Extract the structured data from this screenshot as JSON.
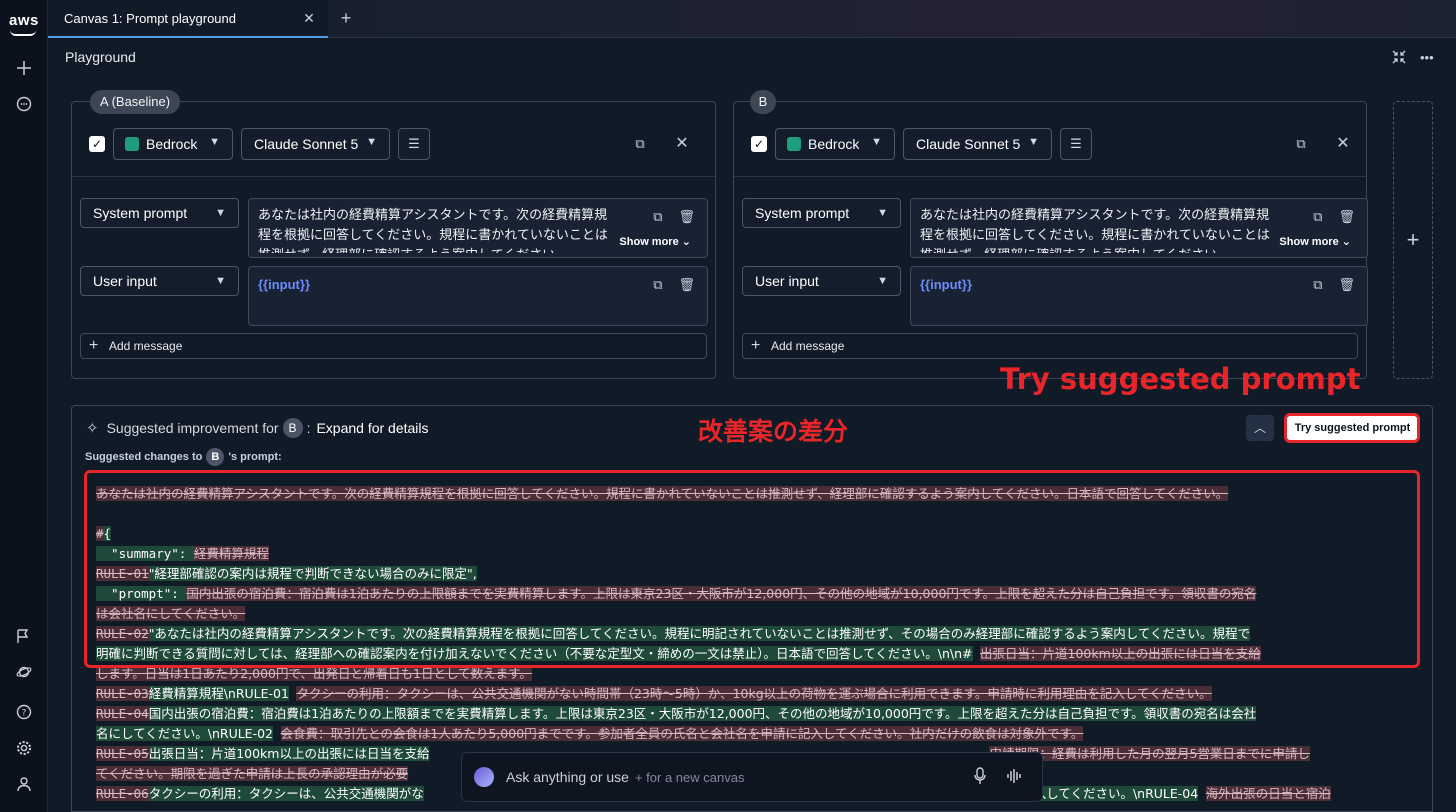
{
  "tab": {
    "title": "Canvas 1: Prompt playground"
  },
  "page": {
    "title": "Playground"
  },
  "panel_a": {
    "tag": "A (Baseline)",
    "provider": "Bedrock",
    "model": "Claude Sonnet 5",
    "system_role": "System prompt",
    "system_text": "あなたは社内の経費精算アシスタントです。次の経費精算規程を根拠に回答してください。規程に書かれていないことは推測せず、経理部に確認するよう案内してください。",
    "show_more": "Show more",
    "user_role": "User input",
    "user_text": "{{input}}",
    "add_message": "Add message"
  },
  "panel_b": {
    "tag": "B",
    "provider": "Bedrock",
    "model": "Claude Sonnet 5",
    "system_role": "System prompt",
    "system_text": "あなたは社内の経費精算アシスタントです。次の経費精算規程を根拠に回答してください。規程に書かれていないことは推測せず、経理部に確認するよう案内してください。",
    "show_more": "Show more",
    "user_role": "User input",
    "user_text": "{{input}}",
    "add_message": "Add message"
  },
  "suggestion": {
    "prefix": "Suggested improvement for",
    "badge": "B",
    "expand": "Expand for details",
    "try_button": "Try suggested prompt",
    "sub_prefix": "Suggested changes to",
    "sub_badge": "B",
    "sub_suffix": "'s prompt:"
  },
  "diff": {
    "l1_del": "あなたは社内の経費精算アシスタントです。次の経費精算規程を根拠に回答してください。規程に書かれていないことは推測せず、経理部に確認するよう案内してください。日本語で回答してください。",
    "l3_del": "#",
    "l3_add": "{",
    "l4_add": "  \"summary\": ",
    "l4_del": "経費精算規程",
    "l5_del": "RULE-01",
    "l5_add": "\"経理部確認の案内は規程で判断できない場合のみに限定\",",
    "l6_add": "  \"prompt\": ",
    "l6_del": "国内出張の宿泊費：宿泊費は1泊あたりの上限額までを実費精算します。上限は東京23区・大阪市が12,000円、その他の地域が10,000円です。上限を超えた分は自己負担です。領収書の宛名",
    "l7_del": "は会社名にしてください。",
    "l8_del": "RULE-02",
    "l8_add": "\"あなたは社内の経費精算アシスタントです。次の経費精算規程を根拠に回答してください。規程に明記されていないことは推測せず、その場合のみ経理部に確認するよう案内してください。規程で",
    "l9_add": "明確に判断できる質問に対しては、経理部への確認案内を付け加えないでください（不要な定型文・締めの一文は禁止）。日本語で回答してください。\\n\\n#",
    "l9_del": "出張日当：片道100km以上の出張には日当を支給",
    "l10_del": "します。日当は1日あたり2,000円で、出発日と帰着日も1日として数えます。",
    "l11_del": "RULE-03",
    "l11_add": "経費精算規程\\nRULE-01",
    "l11_del2": "タクシーの利用：タクシーは、公共交通機関がない時間帯（23時〜5時）か、10kg以上の荷物を運ぶ場合に利用できます。申請時に利用理由を記入してください。",
    "l12_del": "RULE-04",
    "l12_add": "国内出張の宿泊費：宿泊費は1泊あたりの上限額までを実費精算します。上限は東京23区・大阪市が12,000円、その他の地域が10,000円です。上限を超えた分は自己負担です。領収書の宛名は会社",
    "l13_add": "名にしてください。\\nRULE-02",
    "l13_del": "会食費：取引先との会食は1人あたり5,000円までです。参加者全員の氏名と会社名を申請に記入してください。社内だけの飲食は対象外です。",
    "l14_del": "RULE-05",
    "l14_add": "出張日当：片道100km以上の出張には日当を支給",
    "l14_del2": "申請期限：経費は利用した月の翌月5営業日までに申請し",
    "l15_del": "てください。期限を過ぎた申請は上長の承認理由が必要",
    "l16_del": "RULE-06",
    "l16_add": "タクシーの利用：タクシーは、公共交通機関がな",
    "l16_add2": "を記入してください。\\nRULE-04",
    "l16_del2": "海外出張の日当と宿泊"
  },
  "annotations": {
    "try_label": "Try suggested prompt",
    "diff_label": "改善案の差分"
  },
  "ask": {
    "placeholder": "Ask anything or use",
    "hint": "+ for a new canvas"
  }
}
